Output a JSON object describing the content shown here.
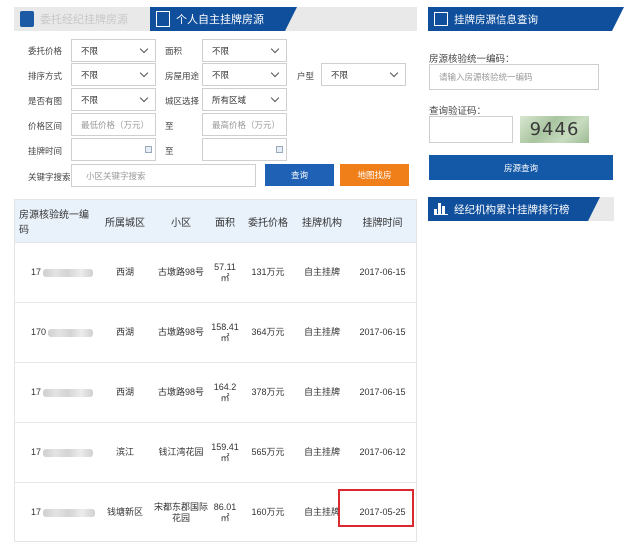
{
  "tabs": [
    {
      "label": "委托经纪挂牌房源",
      "active": false
    },
    {
      "label": "个人自主挂牌房源",
      "active": true
    }
  ],
  "form": {
    "commission_price_label": "委托价格",
    "commission_price_value": "不限",
    "area_label": "面积",
    "area_value": "不限",
    "sort_label": "排序方式",
    "sort_value": "不限",
    "usage_label": "房屋用途",
    "usage_value": "不限",
    "layout_label": "户型",
    "layout_value": "不限",
    "has_image_label": "是否有图",
    "has_image_value": "不限",
    "district_label": "城区选择",
    "district_value": "所有区域",
    "price_range_label": "价格区间",
    "price_min_placeholder": "最低价格（万元）",
    "to_label_1": "至",
    "price_max_placeholder": "最高价格（万元）",
    "list_time_label": "挂牌时间",
    "to_label_2": "至",
    "keyword_label": "关键字搜索",
    "keyword_placeholder": "小区关键字搜索",
    "search_button": "查询",
    "map_button": "地图找房"
  },
  "table": {
    "headers": [
      "房源核验统一编码",
      "所属城区",
      "小区",
      "面积",
      "委托价格",
      "挂牌机构",
      "挂牌时间"
    ],
    "rows": [
      {
        "code": "17",
        "district": "西湖",
        "community": "古墩路98号",
        "area": "57.11",
        "unit": "㎡",
        "price": "131万元",
        "agency": "自主挂牌",
        "date": "2017-06-15"
      },
      {
        "code": "170",
        "district": "西湖",
        "community": "古墩路98号",
        "area": "158.41",
        "unit": "㎡",
        "price": "364万元",
        "agency": "自主挂牌",
        "date": "2017-06-15"
      },
      {
        "code": "17",
        "district": "西湖",
        "community": "古墩路98号",
        "area": "164.2",
        "unit": "㎡",
        "price": "378万元",
        "agency": "自主挂牌",
        "date": "2017-06-15"
      },
      {
        "code": "17",
        "district": "滨江",
        "community": "钱江湾花园",
        "area": "159.41",
        "unit": "㎡",
        "price": "565万元",
        "agency": "自主挂牌",
        "date": "2017-06-12"
      },
      {
        "code": "17",
        "district": "钱塘新区",
        "community": "宋都东郡国际花园",
        "area": "86.01",
        "unit": "㎡",
        "price": "160万元",
        "agency": "自主挂牌",
        "date": "2017-05-25"
      }
    ]
  },
  "sidebar": {
    "query_title": "挂牌房源信息查询",
    "code_label": "房源核验统一编码：",
    "code_placeholder": "请输入房源核验统一编码",
    "captcha_label": "查询验证码：",
    "captcha_text": "9446",
    "query_button": "房源查询",
    "ranking_title": "经纪机构累计挂牌排行榜"
  },
  "colors": {
    "primary": "#0f4f9c",
    "button_blue": "#1f61b4",
    "button_orange": "#f07f1a",
    "highlight_red": "#d9282f"
  }
}
